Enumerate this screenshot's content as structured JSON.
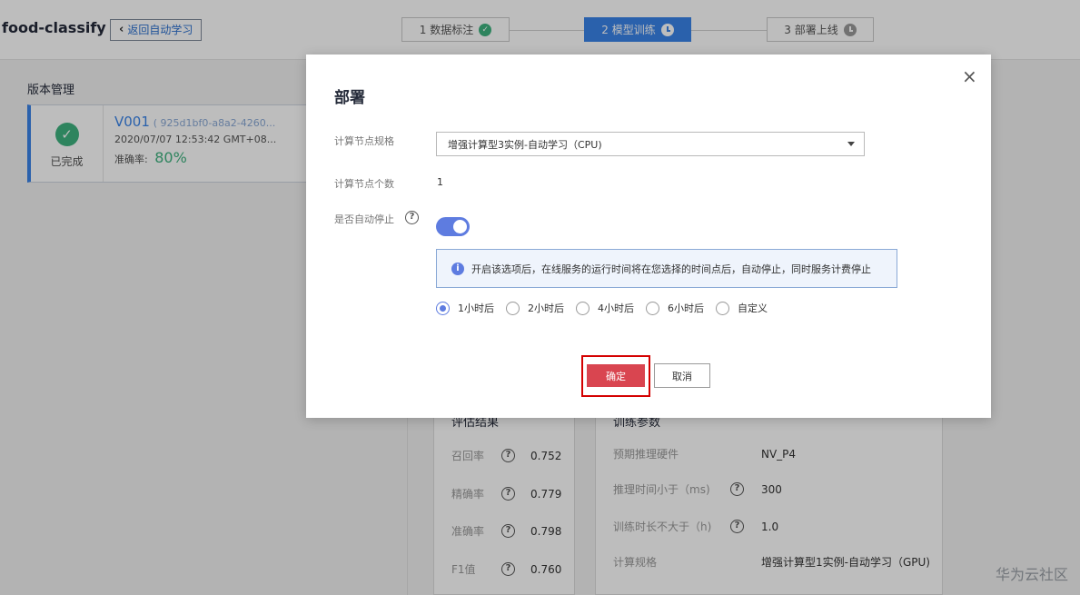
{
  "header": {
    "app_title": "food-classify",
    "back_label": "返回自动学习",
    "steps": [
      {
        "label": "1 数据标注",
        "state": "done"
      },
      {
        "label": "2 模型训练",
        "state": "active"
      },
      {
        "label": "3 部署上线",
        "state": "pending"
      }
    ]
  },
  "versions": {
    "title": "版本管理",
    "card": {
      "status": "已完成",
      "name": "V001",
      "id": "( 925d1bf0-a8a2-4260...",
      "date": "2020/07/07 12:53:42 GMT+08...",
      "accuracy_label": "准确率:",
      "accuracy_value": "80%"
    }
  },
  "evaluation": {
    "title": "评估结果",
    "rows": [
      {
        "label": "召回率",
        "value": "0.752"
      },
      {
        "label": "精确率",
        "value": "0.779"
      },
      {
        "label": "准确率",
        "value": "0.798"
      },
      {
        "label": "F1值",
        "value": "0.760"
      }
    ]
  },
  "training_params": {
    "title": "训练参数",
    "rows": [
      {
        "label": "预期推理硬件",
        "value": "NV_P4",
        "help": false
      },
      {
        "label": "推理时间小于（ms)",
        "value": "300",
        "help": true
      },
      {
        "label": "训练时长不大于（h)",
        "value": "1.0",
        "help": true
      },
      {
        "label": "计算规格",
        "value": "增强计算型1实例-自动学习（GPU)",
        "help": false
      }
    ]
  },
  "watermark": "华为云社区",
  "modal": {
    "title": "部署",
    "spec_label": "计算节点规格",
    "spec_value": "增强计算型3实例-自动学习（CPU)",
    "count_label": "计算节点个数",
    "count_value": "1",
    "auto_stop_label": "是否自动停止",
    "auto_stop_enabled": true,
    "info_text": "开启该选项后，在线服务的运行时间将在您选择的时间点后，自动停止，同时服务计费停止",
    "time_options": [
      "1小时后",
      "2小时后",
      "4小时后",
      "6小时后",
      "自定义"
    ],
    "selected_option": "1小时后",
    "confirm_label": "确定",
    "cancel_label": "取消"
  },
  "colors": {
    "primary": "#3983e8",
    "toggle_on": "#5e7ce0",
    "success": "#3fb27f",
    "confirm_button": "#d94550",
    "highlight_box": "#d40000"
  }
}
